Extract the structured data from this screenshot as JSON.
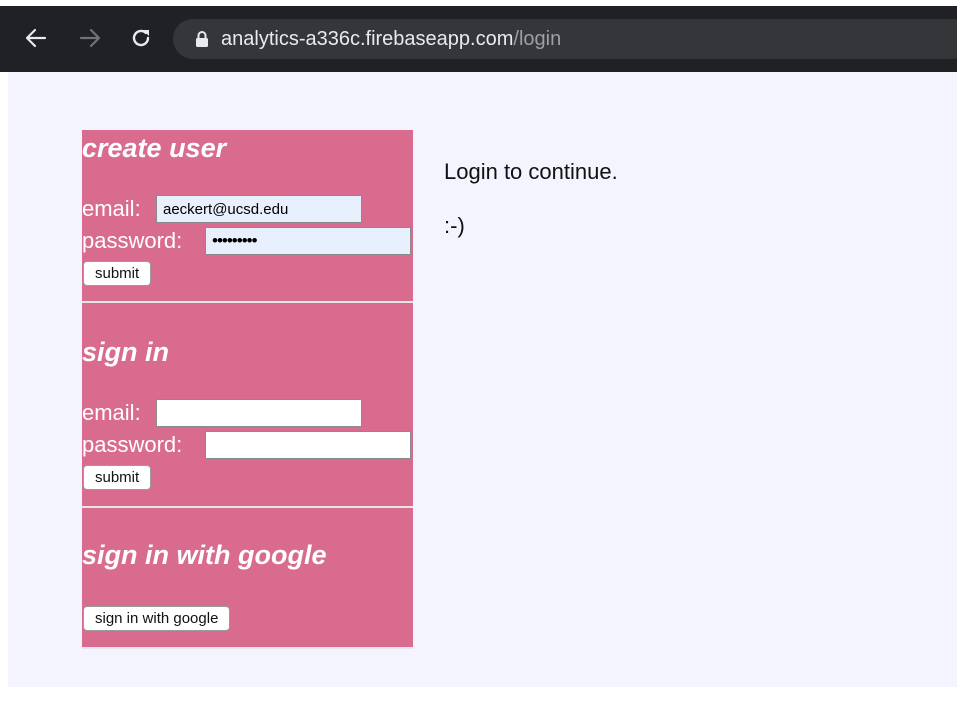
{
  "browser": {
    "url_host": "analytics-a336c.firebaseapp.com",
    "url_path": "/login"
  },
  "create_user": {
    "title": "create user",
    "email_label": "email:",
    "email_value": "aeckert@ucsd.edu",
    "password_label": "password:",
    "password_value": "•••••••••",
    "submit_label": "submit"
  },
  "sign_in": {
    "title": "sign in",
    "email_label": "email:",
    "email_value": "",
    "password_label": "password:",
    "password_value": "",
    "submit_label": "submit"
  },
  "google": {
    "title": "sign in with google",
    "button_label": "sign in with google"
  },
  "side": {
    "message": "Login to continue.",
    "smiley": ":-)"
  },
  "colors": {
    "toolbar": "#202124",
    "panel": "#d86b8e",
    "page_background": "#f3f4fd"
  }
}
